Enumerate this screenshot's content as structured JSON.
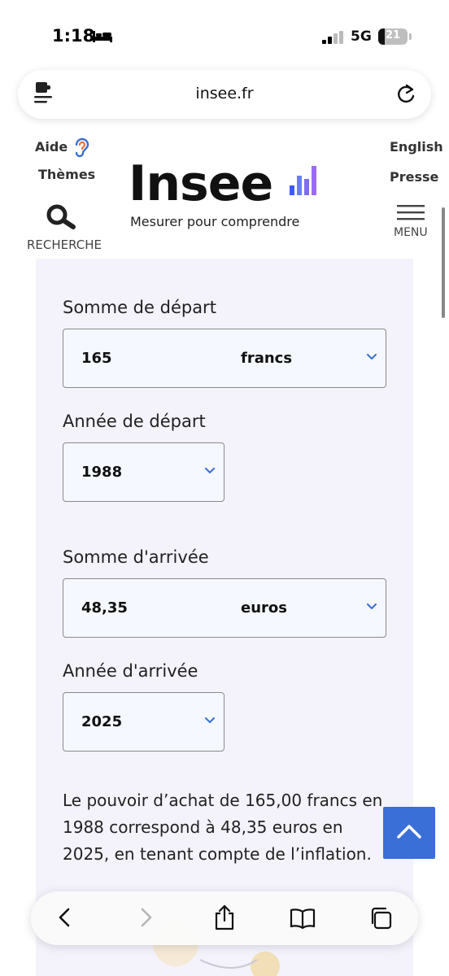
{
  "status": {
    "time": "1:18",
    "network": "5G",
    "battery": "21"
  },
  "browser": {
    "url": "insee.fr"
  },
  "header": {
    "help_label": "Aide",
    "themes_label": "Thèmes",
    "english_label": "English",
    "press_label": "Presse",
    "logo_text": "Insee",
    "tagline": "Mesurer pour comprendre",
    "search_label": "RECHERCHE",
    "menu_label": "MENU"
  },
  "form": {
    "start_sum": {
      "label": "Somme de départ",
      "value": "165",
      "unit": "francs"
    },
    "start_year": {
      "label": "Année de départ",
      "value": "1988"
    },
    "end_sum": {
      "label": "Somme d'arrivée",
      "value": "48,35",
      "unit": "euros"
    },
    "end_year": {
      "label": "Année d'arrivée",
      "value": "2025"
    }
  },
  "result": {
    "text": "Le pouvoir d’achat de 165,00 francs en 1988 correspond à 48,35 euros en 2025, en tenant compte de l’inflation."
  },
  "colors": {
    "accent": "#3a6fd8",
    "panel": "#f4f2fb",
    "logo_bar_blue": "#3d5afe",
    "logo_bar_purple": "#9c6bf5"
  },
  "icons": [
    "bed-icon",
    "signal-icon",
    "extension-icon",
    "reload-icon",
    "ear-icon",
    "search-icon",
    "hamburger-icon",
    "chevron-down-icon",
    "chevron-up-icon",
    "back-icon",
    "forward-icon",
    "share-icon",
    "bookmarks-icon",
    "tabs-icon"
  ]
}
